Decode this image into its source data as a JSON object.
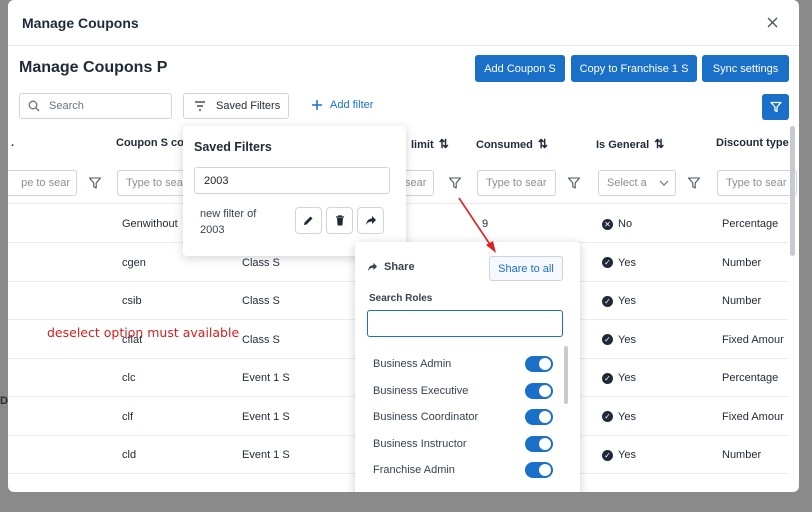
{
  "modal": {
    "title": "Manage Coupons",
    "heading": "Manage Coupons P"
  },
  "toolbar": {
    "add_coupon": "Add Coupon S",
    "copy_franchise": "Copy to Franchise 1 S",
    "sync_settings": "Sync settings",
    "search_placeholder": "Search",
    "saved_filters": "Saved Filters",
    "add_filter": "Add filter"
  },
  "table": {
    "headers": [
      "Coupon S co",
      "limit",
      "Consumed",
      "Is General",
      "Discount type"
    ],
    "first_header_partial": ".",
    "filter_placeholders": [
      "pe to sear",
      "Type to sea",
      "sear",
      "Type to sear",
      "Select a",
      "Type to sear"
    ],
    "rows": [
      {
        "code": "Genwithout",
        "cls": "",
        "consumed": "9",
        "general": "No",
        "discount": "Percentage"
      },
      {
        "code": "cgen",
        "cls": "Class S",
        "consumed": "",
        "general": "Yes",
        "discount": "Number"
      },
      {
        "code": "csib",
        "cls": "Class S",
        "consumed": "",
        "general": "Yes",
        "discount": "Number"
      },
      {
        "code": "cflat",
        "cls": "Class S",
        "consumed": "",
        "general": "Yes",
        "discount": "Fixed Amour"
      },
      {
        "code": "clc",
        "cls": "Event 1 S",
        "consumed": "",
        "general": "Yes",
        "discount": "Percentage"
      },
      {
        "code": "clf",
        "cls": "Event 1 S",
        "consumed": "",
        "general": "Yes",
        "discount": "Fixed Amour"
      },
      {
        "code": "cld",
        "cls": "Event 1 S",
        "consumed": "",
        "general": "Yes",
        "discount": "Number"
      }
    ]
  },
  "annotation": "deselect option must available",
  "saved_filters_popover": {
    "title": "Saved Filters",
    "search_value": "2003",
    "item_label": "new filter of 2003"
  },
  "share_popover": {
    "title": "Share",
    "share_all": "Share to all",
    "roles_label": "Search Roles",
    "roles": [
      "Business Admin",
      "Business Executive",
      "Business Coordinator",
      "Business Instructor",
      "Franchise Admin"
    ]
  },
  "colors": {
    "primary": "#1a6fc9",
    "annotation": "#d32020"
  }
}
